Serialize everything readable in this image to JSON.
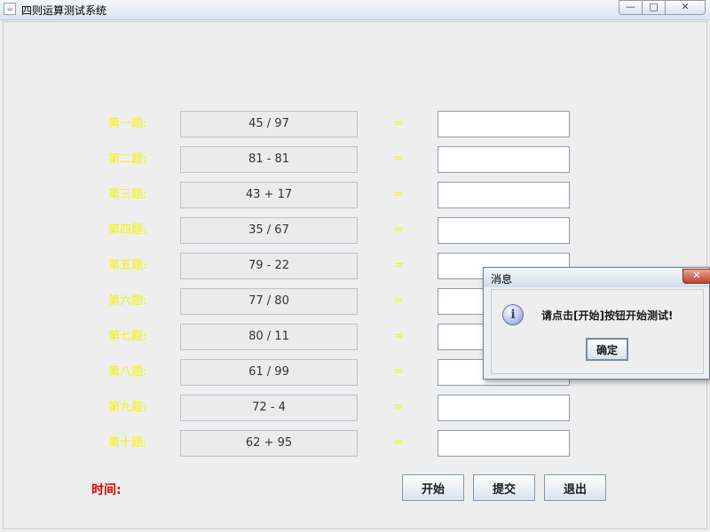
{
  "window": {
    "icon": "java-cup-icon",
    "title": "四则运算测试系统",
    "controls": {
      "minimize": "—",
      "maximize": "□",
      "close": "✕"
    }
  },
  "questions": [
    {
      "label": "第一题:",
      "expression": "45 / 97",
      "equals": "=",
      "answer": ""
    },
    {
      "label": "第二题:",
      "expression": "81 - 81",
      "equals": "=",
      "answer": ""
    },
    {
      "label": "第三题:",
      "expression": "43 + 17",
      "equals": "=",
      "answer": ""
    },
    {
      "label": "第四题:",
      "expression": "35 / 67",
      "equals": "=",
      "answer": ""
    },
    {
      "label": "第五题:",
      "expression": "79 - 22",
      "equals": "=",
      "answer": ""
    },
    {
      "label": "第六题:",
      "expression": "77 / 80",
      "equals": "=",
      "answer": ""
    },
    {
      "label": "第七题:",
      "expression": "80 / 11",
      "equals": "=",
      "answer": ""
    },
    {
      "label": "第八题:",
      "expression": "61 / 99",
      "equals": "=",
      "answer": ""
    },
    {
      "label": "第九题:",
      "expression": "72 - 4",
      "equals": "=",
      "answer": ""
    },
    {
      "label": "第十题:",
      "expression": "62 + 95",
      "equals": "=",
      "answer": ""
    }
  ],
  "footer": {
    "time_label": "时间:",
    "buttons": {
      "start": "开始",
      "submit": "提交",
      "exit": "退出"
    }
  },
  "dialog": {
    "title": "消息",
    "icon": "info-icon",
    "icon_glyph": "i",
    "message": "请点击[开始]按钮开始测试!",
    "ok": "确定",
    "close": "✕"
  },
  "colors": {
    "label_yellow": "#f4f400",
    "time_red": "#e00000",
    "background": "#eeeeee"
  }
}
